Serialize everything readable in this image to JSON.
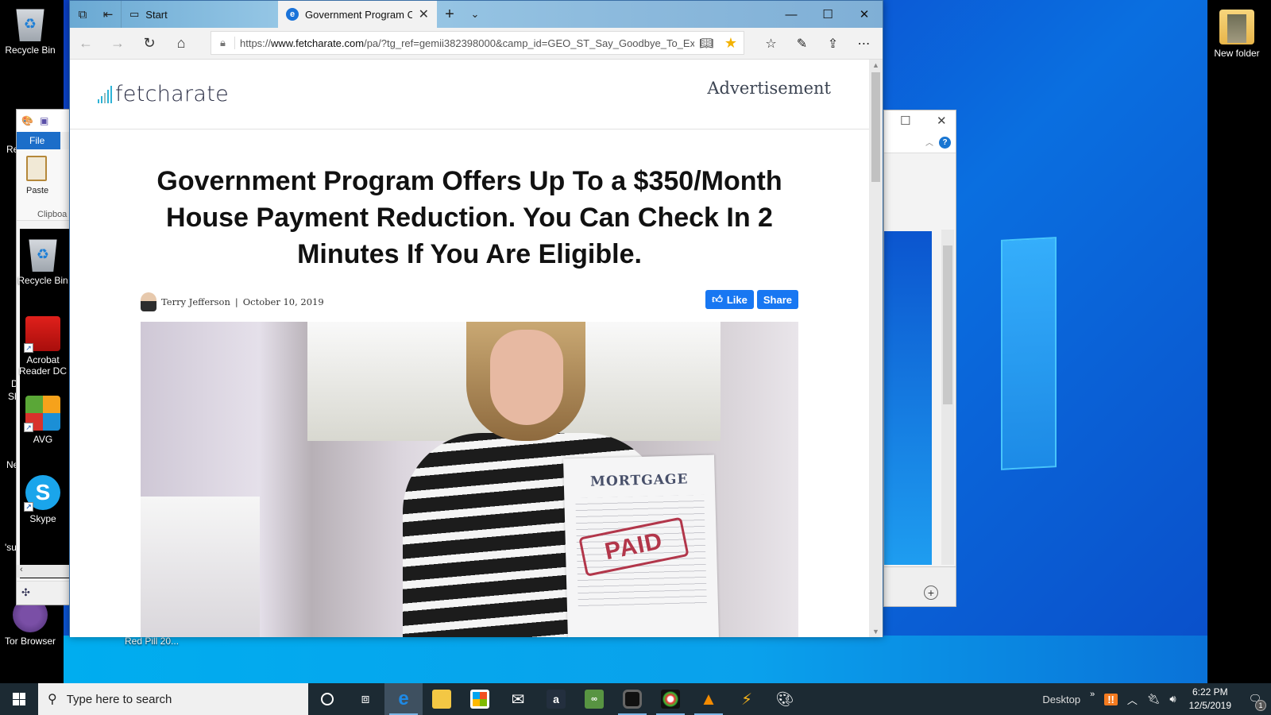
{
  "desktop": {
    "icons_left": [
      {
        "label": "Recycle Bin",
        "icon": "recycle-bin-icon"
      },
      {
        "label": "Tor Browser",
        "icon": "tor-browser-icon"
      }
    ],
    "icons_right": [
      {
        "label": "New folder",
        "icon": "folder-icon"
      }
    ],
    "partial_labels": [
      "Re",
      "D",
      "Sh",
      "Ne",
      "'su"
    ],
    "bottom_label": "Red Pill 20..."
  },
  "paint_window": {
    "file_tab": "File",
    "paste_label": "Paste",
    "clipboard_label": "Clipboa",
    "inner_icons": [
      {
        "label": "Recycle Bin",
        "icon": "recycle-bin-icon"
      },
      {
        "label": "Acrobat Reader DC",
        "icon": "acrobat-icon"
      },
      {
        "label": "AVG",
        "icon": "avg-icon"
      },
      {
        "label": "Skype",
        "icon": "skype-icon"
      }
    ]
  },
  "browser": {
    "tabs": [
      {
        "label": "Start",
        "active": false
      },
      {
        "label": "Government Program C",
        "active": true
      }
    ],
    "url_prefix": "https://",
    "url_domain": "www.fetcharate.com",
    "url_rest": "/pa/?tg_ref=gemii382398000&camp_id=GEO_ST_Say_Goodbye_To_Exp",
    "favorite_active": true
  },
  "page": {
    "logo_text": "fetcharate",
    "ad_label": "Advertisement",
    "headline": "Government Program Offers Up To a $350/Month House Payment Reduction. You Can Check In 2 Minutes If You Are Eligible.",
    "author": "Terry Jefferson",
    "date": "October 10, 2019",
    "like_label": "Like",
    "share_label": "Share",
    "image_doc_title": "MORTGAGE",
    "image_stamp": "PAID"
  },
  "taskbar": {
    "search_placeholder": "Type here to search",
    "apps": [
      "task-view",
      "edge",
      "file-explorer",
      "store",
      "mail",
      "amazon",
      "tripadvisor",
      "camera",
      "camera-color",
      "vlc",
      "winamp",
      "paint"
    ],
    "desktop_label": "Desktop",
    "time": "6:22 PM",
    "date": "12/5/2019",
    "notification_count": "1"
  },
  "colors": {
    "accent_blue": "#1877f2",
    "favorite_star": "#f3b200",
    "logo_bars": "#2db3d6",
    "stamp_red": "#b2364a"
  }
}
